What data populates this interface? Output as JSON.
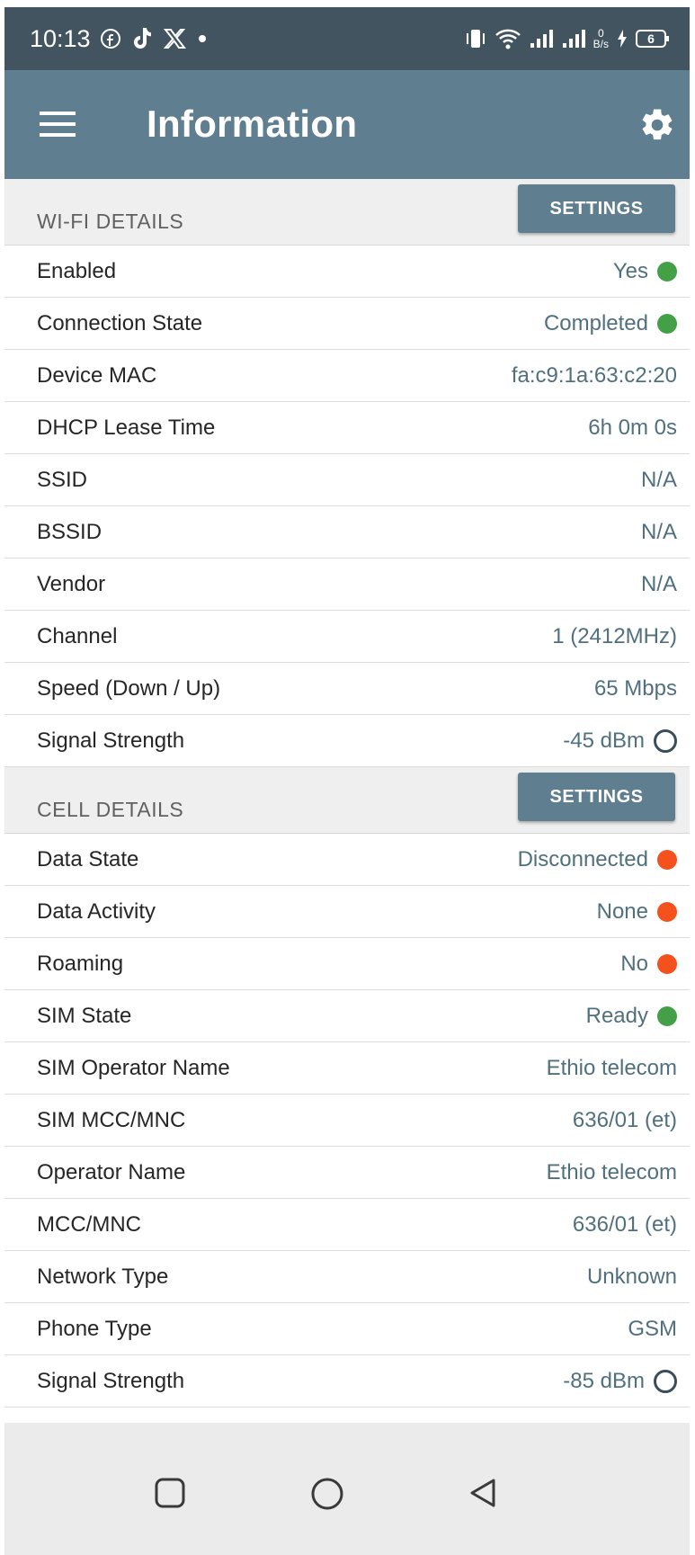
{
  "status_bar": {
    "time": "10:13",
    "left_icons": [
      "facebook-icon",
      "tiktok-icon",
      "x-icon",
      "dot-icon"
    ],
    "right_icons": [
      "vibrate-icon",
      "wifi-icon",
      "signal-icon",
      "signal-icon",
      "net-speed-icon",
      "battery-icon"
    ],
    "net_speed": "0",
    "net_speed_unit": "B/s",
    "battery_level": "6"
  },
  "app_bar": {
    "title": "Information",
    "menu_icon": "hamburger-menu-icon",
    "settings_icon": "gear-icon"
  },
  "wifi": {
    "header": "WI-FI DETAILS",
    "button": "SETTINGS",
    "rows": [
      {
        "key": "Enabled",
        "value": "Yes",
        "indicator": "dot",
        "color": "#43a047"
      },
      {
        "key": "Connection State",
        "value": "Completed",
        "indicator": "dot",
        "color": "#43a047"
      },
      {
        "key": "Device MAC",
        "value": "fa:c9:1a:63:c2:20"
      },
      {
        "key": "DHCP Lease Time",
        "value": "6h 0m 0s"
      },
      {
        "key": "SSID",
        "value": "N/A"
      },
      {
        "key": "BSSID",
        "value": "N/A"
      },
      {
        "key": "Vendor",
        "value": "N/A"
      },
      {
        "key": "Channel",
        "value": "1 (2412MHz)"
      },
      {
        "key": "Speed (Down / Up)",
        "value": "65 Mbps"
      },
      {
        "key": "Signal Strength",
        "value": "-45 dBm",
        "indicator": "ring",
        "color": "#3b4d59"
      }
    ]
  },
  "cell": {
    "header": "CELL DETAILS",
    "button": "SETTINGS",
    "rows": [
      {
        "key": "Data State",
        "value": "Disconnected",
        "indicator": "dot",
        "color": "#f4511e"
      },
      {
        "key": "Data Activity",
        "value": "None",
        "indicator": "dot",
        "color": "#f4511e"
      },
      {
        "key": "Roaming",
        "value": "No",
        "indicator": "dot",
        "color": "#f4511e"
      },
      {
        "key": "SIM State",
        "value": "Ready",
        "indicator": "dot",
        "color": "#43a047"
      },
      {
        "key": "SIM Operator Name",
        "value": "Ethio telecom"
      },
      {
        "key": "SIM MCC/MNC",
        "value": "636/01 (et)"
      },
      {
        "key": "Operator Name",
        "value": "Ethio telecom"
      },
      {
        "key": "MCC/MNC",
        "value": "636/01 (et)"
      },
      {
        "key": "Network Type",
        "value": "Unknown"
      },
      {
        "key": "Phone Type",
        "value": "GSM"
      },
      {
        "key": "Signal Strength",
        "value": "-85 dBm",
        "indicator": "ring",
        "color": "#3b4d59"
      }
    ]
  },
  "nav_bar": {
    "buttons": [
      "recents-icon",
      "home-icon",
      "back-icon"
    ]
  }
}
